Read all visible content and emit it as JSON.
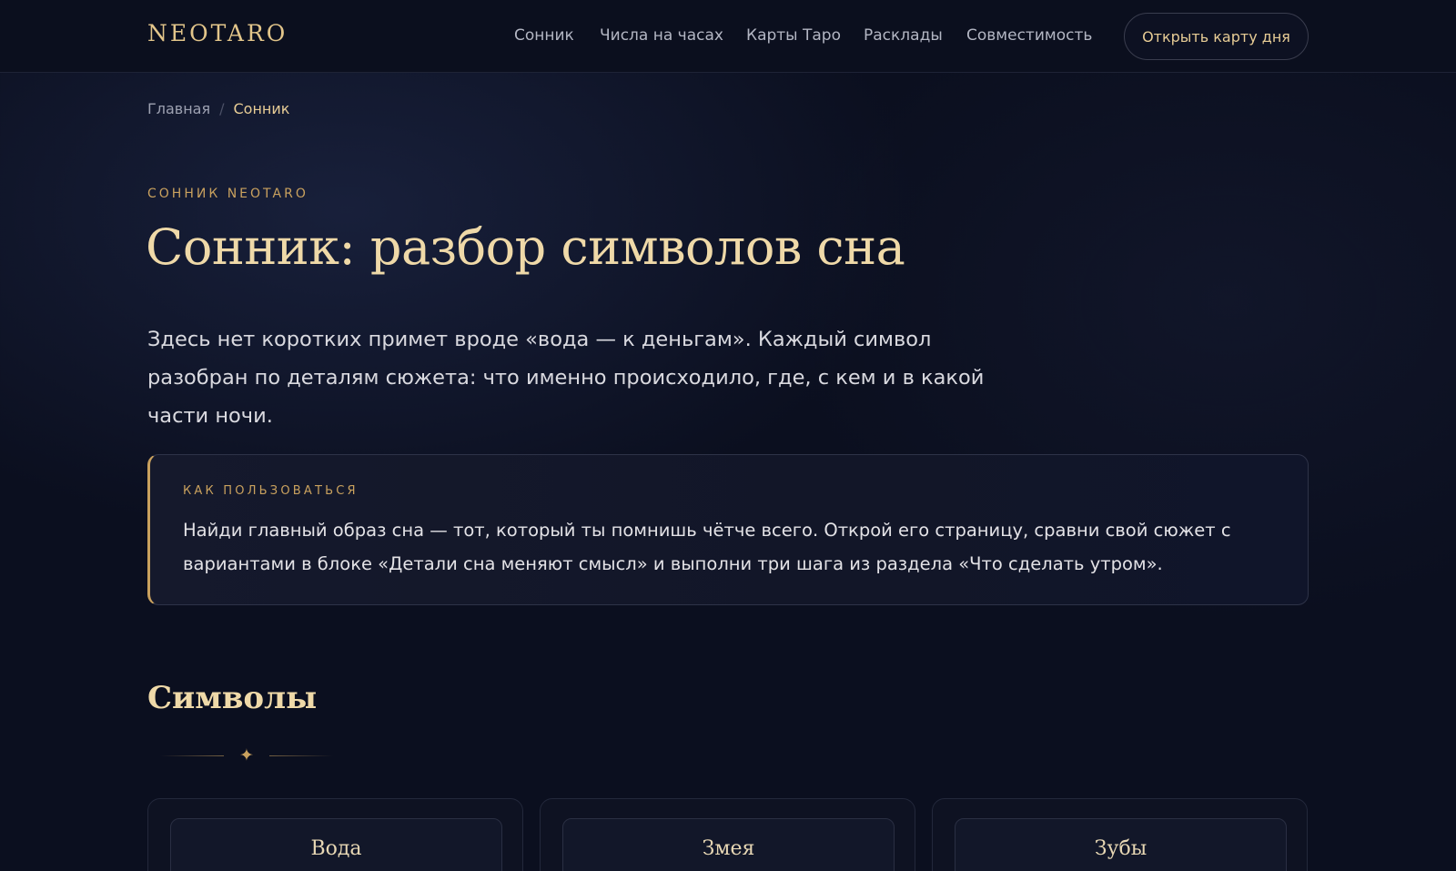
{
  "header": {
    "logo": "NEOTARO",
    "nav": [
      "Сонник",
      "Числа на часах",
      "Карты Таро",
      "Расклады",
      "Совместимость"
    ],
    "cta_label": "Открыть карту дня"
  },
  "breadcrumb": {
    "home": "Главная",
    "separator": "/",
    "current": "Сонник"
  },
  "hero": {
    "eyebrow": "СОННИК NEOTARO",
    "title": "Сонник: разбор символов сна",
    "lead": "Здесь нет коротких примет вроде «вода — к деньгам». Каждый символ разобран по деталям сюжета: что именно происходило, где, с кем и в какой части ночи."
  },
  "howto": {
    "label": "КАК ПОЛЬЗОВАТЬСЯ",
    "text": "Найди главный образ сна — тот, который ты помнишь чётче всего. Открой его страницу, сравни свой сюжет с вариантами в блоке «Детали сна меняют смысл» и выполни три шага из раздела «Что сделать утром»."
  },
  "symbols": {
    "title": "Символы",
    "divider_glyph": "✦",
    "cards": [
      "Вода",
      "Змея",
      "Зубы"
    ]
  },
  "colors": {
    "accent_gold": "#c9a15e",
    "title_gold": "#efd9a8",
    "background": "#0b0f1f"
  }
}
